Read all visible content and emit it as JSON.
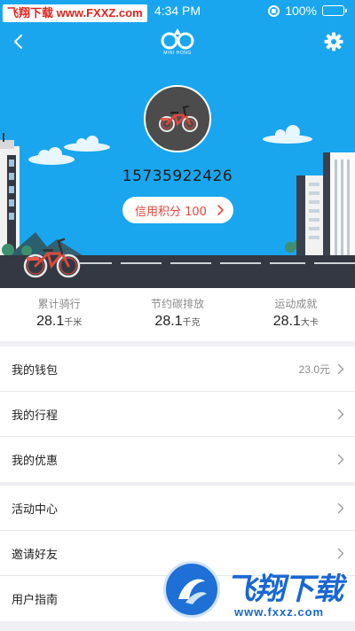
{
  "status_bar": {
    "watermark": "飞翔下载 www.FXXZ.com",
    "time": "4:34 PM",
    "battery": "100%"
  },
  "header": {
    "logo_text": "MINI HONG"
  },
  "profile": {
    "phone": "15735922426",
    "credit_label": "信用积分 100"
  },
  "stats": [
    {
      "label": "累计骑行",
      "value": "28.1",
      "unit": "千米"
    },
    {
      "label": "节约碳排放",
      "value": "28.1",
      "unit": "千克"
    },
    {
      "label": "运动成就",
      "value": "28.1",
      "unit": "大卡"
    }
  ],
  "menu_group_1": [
    {
      "label": "我的钱包",
      "value": "23.0元"
    },
    {
      "label": "我的行程"
    },
    {
      "label": "我的优惠"
    }
  ],
  "menu_group_2": [
    {
      "label": "活动中心"
    },
    {
      "label": "邀请好友"
    },
    {
      "label": "用户指南"
    }
  ],
  "watermark_bottom": {
    "brand": "飞翔下载",
    "url": "www.fxxz.com"
  },
  "colors": {
    "sky": "#1aa6ee",
    "accent_red": "#e9443a",
    "road": "#333842"
  },
  "icons": [
    "chevron-left-icon",
    "gear-icon",
    "bike-icon",
    "chevron-right-icon"
  ]
}
